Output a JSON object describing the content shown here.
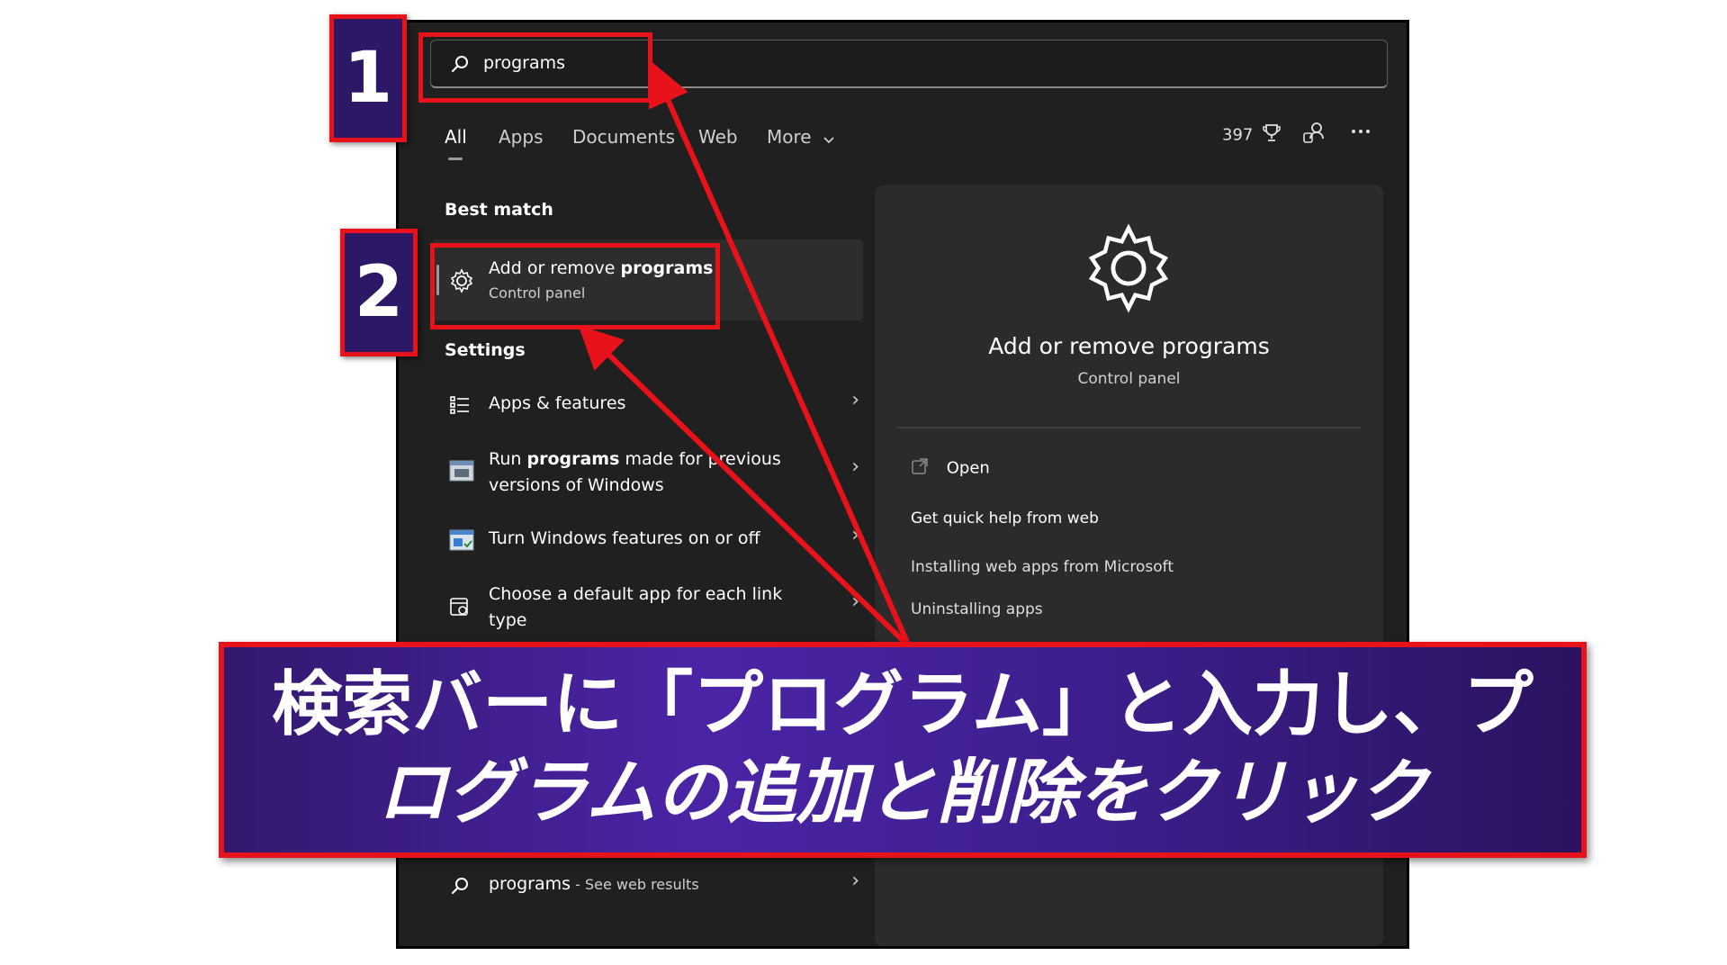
{
  "search": {
    "query": "programs"
  },
  "tabs": [
    {
      "label": "All",
      "active": true
    },
    {
      "label": "Apps",
      "active": false
    },
    {
      "label": "Documents",
      "active": false
    },
    {
      "label": "Web",
      "active": false
    },
    {
      "label": "More",
      "active": false
    }
  ],
  "toolbar": {
    "points": "397"
  },
  "sections": {
    "best_match": "Best match",
    "settings": "Settings"
  },
  "best_match": {
    "title_prefix": "Add or remove ",
    "title_bold": "programs",
    "subtitle": "Control panel"
  },
  "settings_items": [
    {
      "icon": "list-icon",
      "text": "Apps & features"
    },
    {
      "icon": "window-icon",
      "pre": "Run ",
      "bold": "programs",
      "post": " made for previous",
      "line2": "versions of Windows"
    },
    {
      "icon": "features-icon",
      "text": "Turn Windows features on or off"
    },
    {
      "icon": "default-app-icon",
      "line1": "Choose a default app for each link",
      "line2": "type"
    }
  ],
  "web_result": {
    "query": "programs",
    "suffix": " - See web results"
  },
  "preview": {
    "title": "Add or remove programs",
    "subtitle": "Control panel",
    "open_label": "Open",
    "help_heading": "Get quick help from web",
    "help_links": [
      "Installing web apps from Microsoft",
      "Uninstalling apps"
    ]
  },
  "annotations": {
    "step1": "1",
    "step2": "2",
    "banner_line1": "検索バーに「プログラム」と入力し、プ",
    "banner_line2": "ログラムの追加と削除をクリック",
    "accent_color": "#e8121b",
    "badge_color": "#2c1866"
  }
}
